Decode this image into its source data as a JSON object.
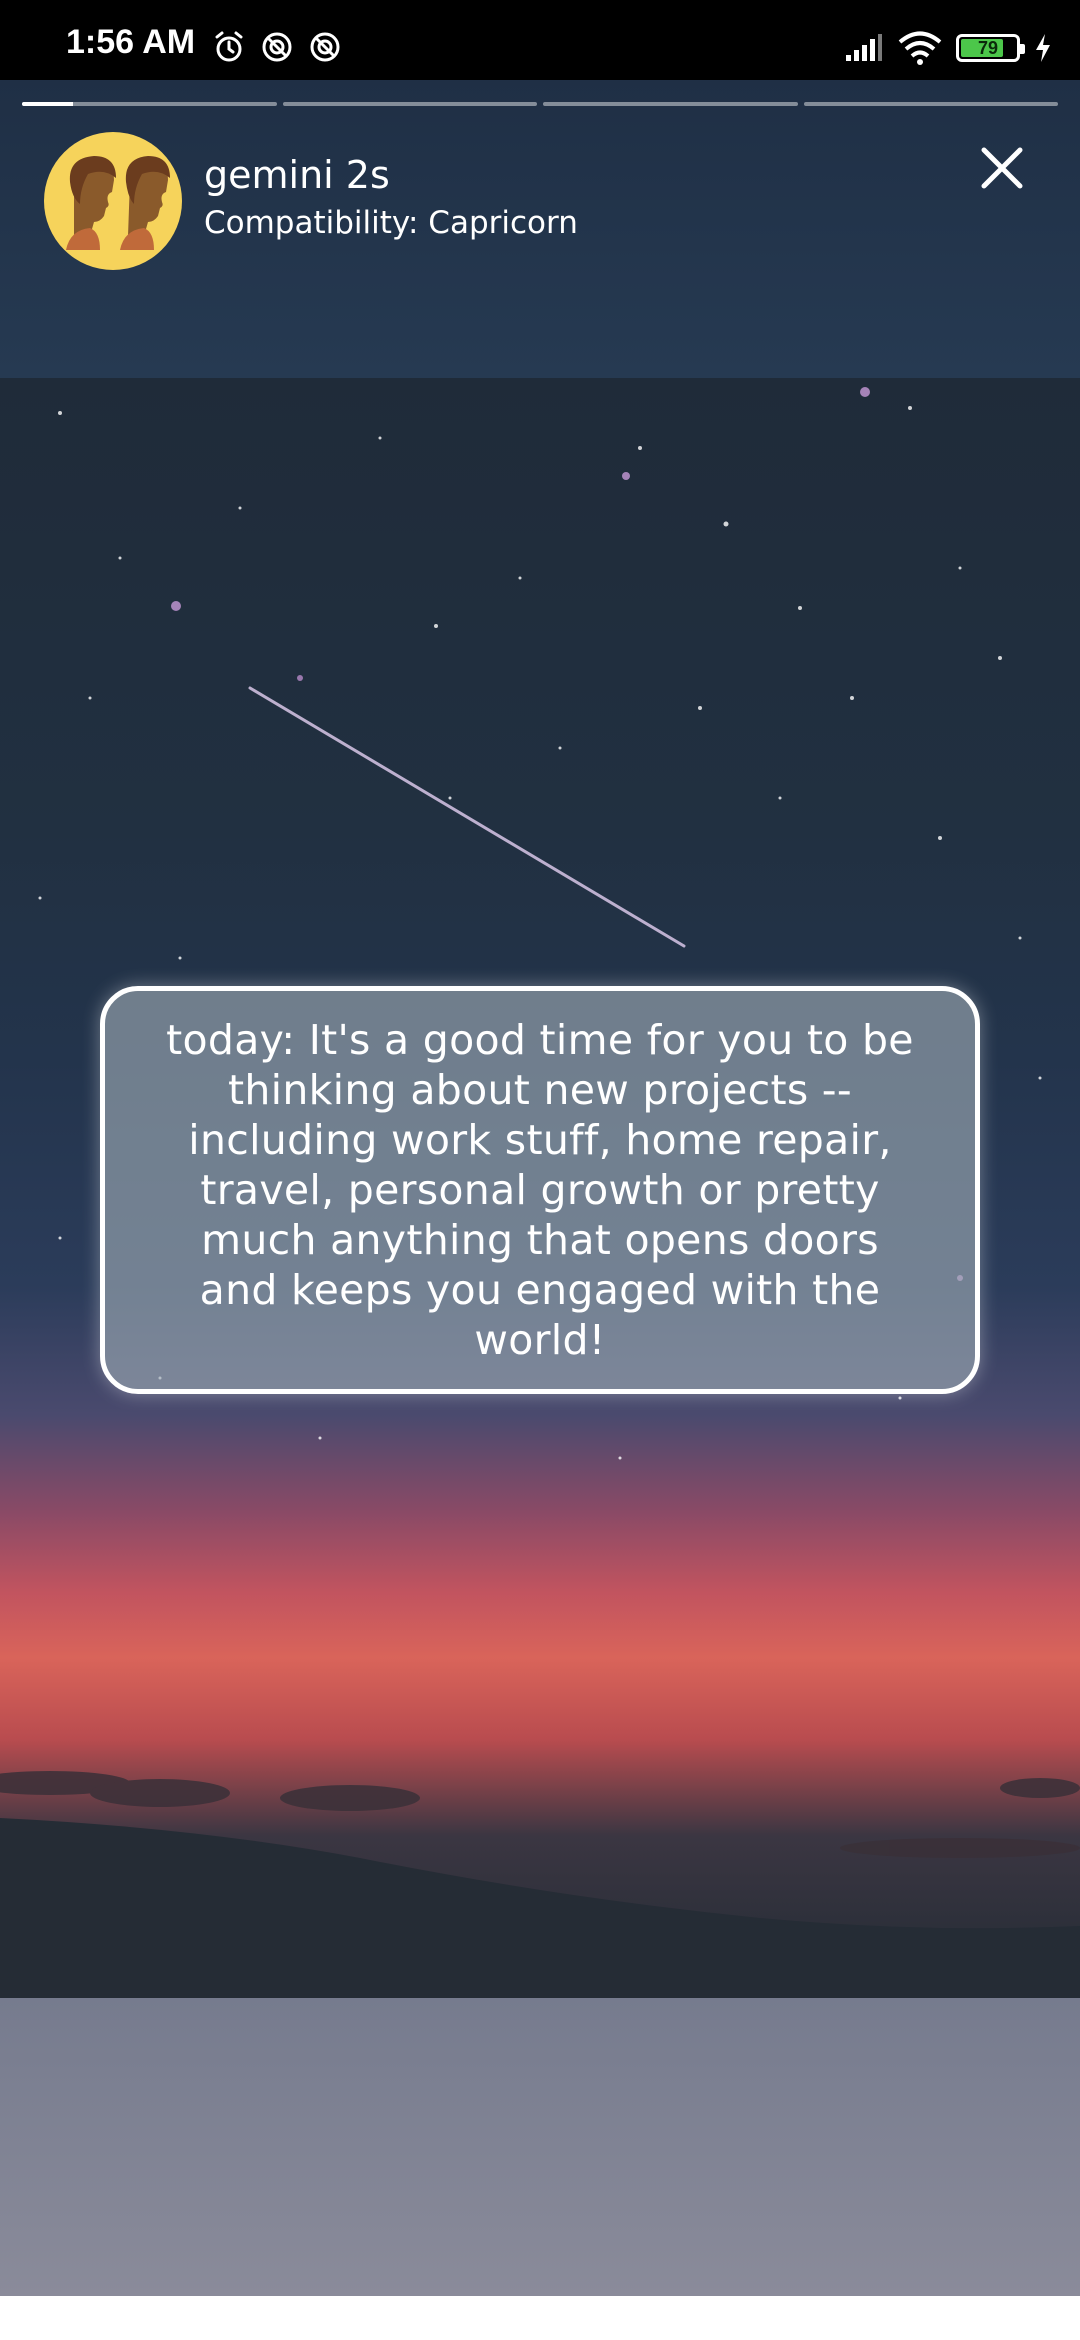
{
  "status_bar": {
    "time": "1:56 AM",
    "left_icons": [
      "alarm-icon",
      "sync-off-icon",
      "sync-off-icon"
    ],
    "right_icons": [
      "signal-icon",
      "wifi-icon",
      "battery-icon",
      "charging-icon"
    ],
    "battery_level": "79",
    "battery_fraction": 0.79
  },
  "story": {
    "segments": 4,
    "active_segment": 0,
    "active_progress_fraction": 0.2,
    "profile": {
      "name": "gemini 2s",
      "subtitle": "Compatibility: Capricorn",
      "avatar_icon": "gemini-twins-icon"
    },
    "close_icon": "close-icon",
    "quote": "today: It's a good time for you to be thinking about new projects -- including work stuff, home repair, travel, personal growth or pretty much anything that opens doors and keeps you engaged with the world!"
  },
  "colors": {
    "status_bar": "#000000",
    "header": "#233449",
    "avatar_bg": "#f6d35b",
    "battery_fill": "#4cc74a",
    "bottom_panel": "#80838f"
  }
}
